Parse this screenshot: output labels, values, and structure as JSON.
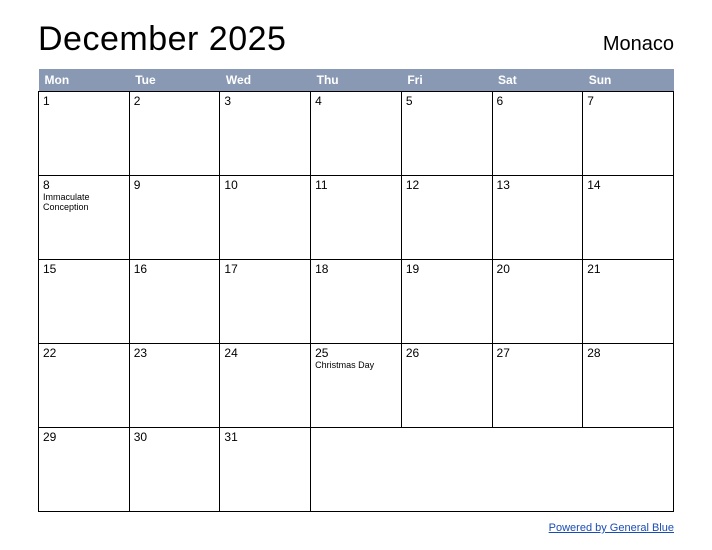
{
  "header": {
    "month_title": "December 2025",
    "location": "Monaco"
  },
  "weekdays": [
    "Mon",
    "Tue",
    "Wed",
    "Thu",
    "Fri",
    "Sat",
    "Sun"
  ],
  "weeks": [
    [
      {
        "day": "1"
      },
      {
        "day": "2"
      },
      {
        "day": "3"
      },
      {
        "day": "4"
      },
      {
        "day": "5"
      },
      {
        "day": "6"
      },
      {
        "day": "7"
      }
    ],
    [
      {
        "day": "8",
        "event": "Immaculate Conception"
      },
      {
        "day": "9"
      },
      {
        "day": "10"
      },
      {
        "day": "11"
      },
      {
        "day": "12"
      },
      {
        "day": "13"
      },
      {
        "day": "14"
      }
    ],
    [
      {
        "day": "15"
      },
      {
        "day": "16"
      },
      {
        "day": "17"
      },
      {
        "day": "18"
      },
      {
        "day": "19"
      },
      {
        "day": "20"
      },
      {
        "day": "21"
      }
    ],
    [
      {
        "day": "22"
      },
      {
        "day": "23"
      },
      {
        "day": "24"
      },
      {
        "day": "25",
        "event": "Christmas Day"
      },
      {
        "day": "26"
      },
      {
        "day": "27"
      },
      {
        "day": "28"
      }
    ],
    [
      {
        "day": "29"
      },
      {
        "day": "30"
      },
      {
        "day": "31"
      },
      {
        "day": ""
      },
      {
        "day": ""
      },
      {
        "day": ""
      },
      {
        "day": ""
      }
    ]
  ],
  "footer": {
    "link_text": "Powered by General Blue"
  }
}
